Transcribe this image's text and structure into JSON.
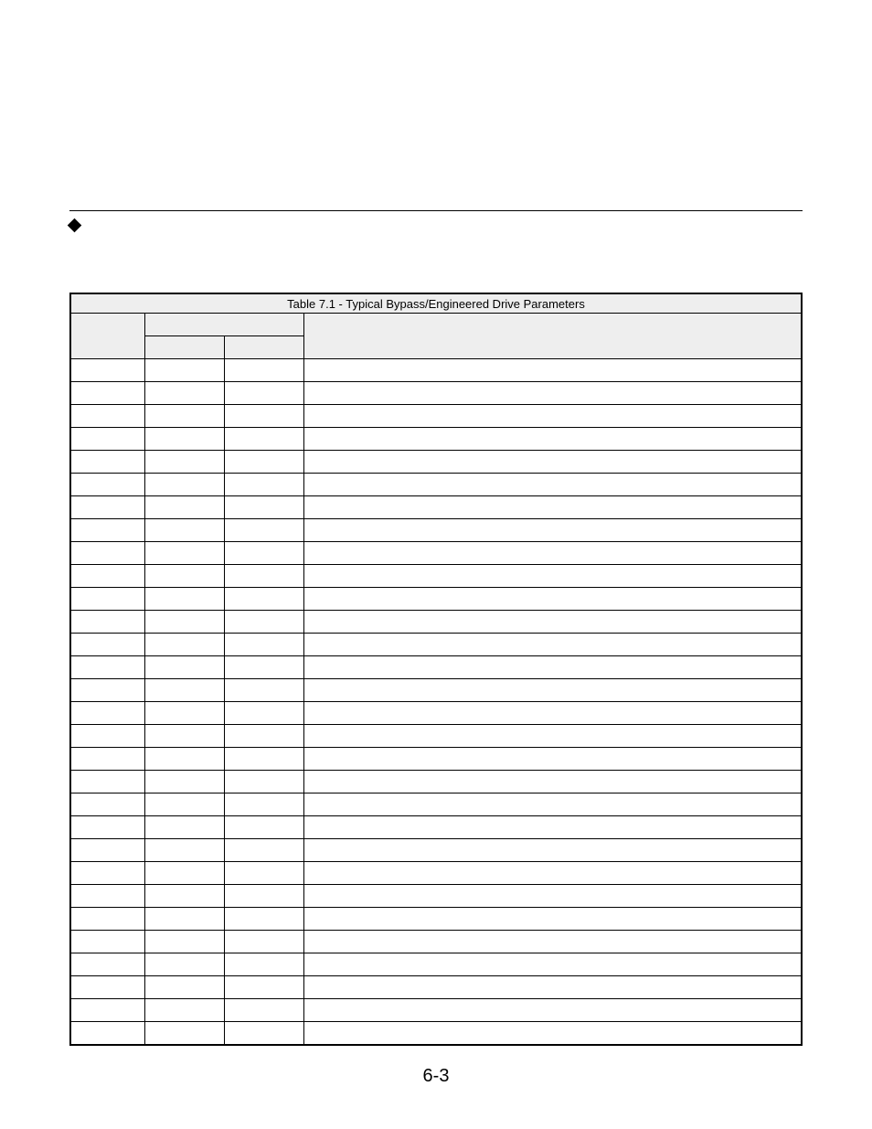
{
  "table": {
    "caption": "Table 7.1 - Typical Bypass/Engineered Drive Parameters",
    "header": {
      "c1": "",
      "c2": "",
      "c3": "",
      "c4": ""
    },
    "sub": {
      "c2": "",
      "c3": ""
    },
    "rows": [
      {
        "c1": "",
        "c2": "",
        "c3": "",
        "c4": ""
      },
      {
        "c1": "",
        "c2": "",
        "c3": "",
        "c4": ""
      },
      {
        "c1": "",
        "c2": "",
        "c3": "",
        "c4": ""
      },
      {
        "c1": "",
        "c2": "",
        "c3": "",
        "c4": ""
      },
      {
        "c1": "",
        "c2": "",
        "c3": "",
        "c4": ""
      },
      {
        "c1": "",
        "c2": "",
        "c3": "",
        "c4": ""
      },
      {
        "c1": "",
        "c2": "",
        "c3": "",
        "c4": ""
      },
      {
        "c1": "",
        "c2": "",
        "c3": "",
        "c4": ""
      },
      {
        "c1": "",
        "c2": "",
        "c3": "",
        "c4": ""
      },
      {
        "c1": "",
        "c2": "",
        "c3": "",
        "c4": ""
      },
      {
        "c1": "",
        "c2": "",
        "c3": "",
        "c4": ""
      },
      {
        "c1": "",
        "c2": "",
        "c3": "",
        "c4": ""
      },
      {
        "c1": "",
        "c2": "",
        "c3": "",
        "c4": ""
      },
      {
        "c1": "",
        "c2": "",
        "c3": "",
        "c4": ""
      },
      {
        "c1": "",
        "c2": "",
        "c3": "",
        "c4": ""
      },
      {
        "c1": "",
        "c2": "",
        "c3": "",
        "c4": ""
      },
      {
        "c1": "",
        "c2": "",
        "c3": "",
        "c4": ""
      },
      {
        "c1": "",
        "c2": "",
        "c3": "",
        "c4": ""
      },
      {
        "c1": "",
        "c2": "",
        "c3": "",
        "c4": ""
      },
      {
        "c1": "",
        "c2": "",
        "c3": "",
        "c4": ""
      },
      {
        "c1": "",
        "c2": "",
        "c3": "",
        "c4": ""
      },
      {
        "c1": "",
        "c2": "",
        "c3": "",
        "c4": ""
      },
      {
        "c1": "",
        "c2": "",
        "c3": "",
        "c4": ""
      },
      {
        "c1": "",
        "c2": "",
        "c3": "",
        "c4": ""
      },
      {
        "c1": "",
        "c2": "",
        "c3": "",
        "c4": ""
      },
      {
        "c1": "",
        "c2": "",
        "c3": "",
        "c4": ""
      },
      {
        "c1": "",
        "c2": "",
        "c3": "",
        "c4": ""
      },
      {
        "c1": "",
        "c2": "",
        "c3": "",
        "c4": ""
      },
      {
        "c1": "",
        "c2": "",
        "c3": "",
        "c4": ""
      },
      {
        "c1": "",
        "c2": "",
        "c3": "",
        "c4": ""
      }
    ]
  },
  "page_number": "6-3"
}
